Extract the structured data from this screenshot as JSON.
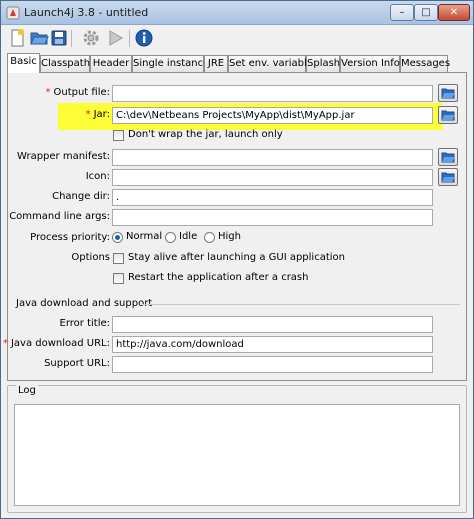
{
  "window": {
    "title": "Launch4j 3.8 - untitled",
    "controls": {
      "minimize": "–",
      "maximize": "□",
      "close": "✕"
    }
  },
  "toolbar": {
    "buttons": [
      "new-icon",
      "open-icon",
      "save-icon",
      "build-gear-icon",
      "run-icon",
      "info-icon"
    ]
  },
  "tabs": [
    {
      "label": "Basic",
      "active": true
    },
    {
      "label": "Classpath"
    },
    {
      "label": "Header"
    },
    {
      "label": "Single instance"
    },
    {
      "label": "JRE"
    },
    {
      "label": "Set env. variables"
    },
    {
      "label": "Splash"
    },
    {
      "label": "Version Info"
    },
    {
      "label": "Messages"
    }
  ],
  "basic": {
    "required_mark": "*",
    "output_file": {
      "label": "Output file:",
      "value": ""
    },
    "jar": {
      "label": "Jar:",
      "value": "C:\\dev\\Netbeans Projects\\MyApp\\dist\\MyApp.jar"
    },
    "dont_wrap": {
      "label": "Don't wrap the jar, launch only",
      "checked": false
    },
    "wrapper_manifest": {
      "label": "Wrapper manifest:",
      "value": ""
    },
    "icon": {
      "label": "Icon:",
      "value": ""
    },
    "change_dir": {
      "label": "Change dir:",
      "value": "."
    },
    "cmd_args": {
      "label": "Command line args:",
      "value": ""
    },
    "process_priority": {
      "label": "Process priority:",
      "options": [
        "Normal",
        "Idle",
        "High"
      ],
      "selected": "Normal"
    },
    "options": {
      "label": "Options",
      "stay_alive": {
        "label": "Stay alive after launching a GUI application",
        "checked": false
      },
      "restart": {
        "label": "Restart the application after a crash",
        "checked": false
      }
    },
    "java_download": {
      "group_title": "Java download and support",
      "error_title": {
        "label": "Error title:",
        "value": ""
      },
      "download_url": {
        "label": "Java download URL:",
        "value": "http://java.com/download"
      },
      "support_url": {
        "label": "Support URL:",
        "value": ""
      }
    }
  },
  "log": {
    "title": "Log",
    "content": ""
  },
  "colors": {
    "highlight": "#fdfd38",
    "required": "#e02020",
    "radio_selected": "#1e5fb4"
  }
}
